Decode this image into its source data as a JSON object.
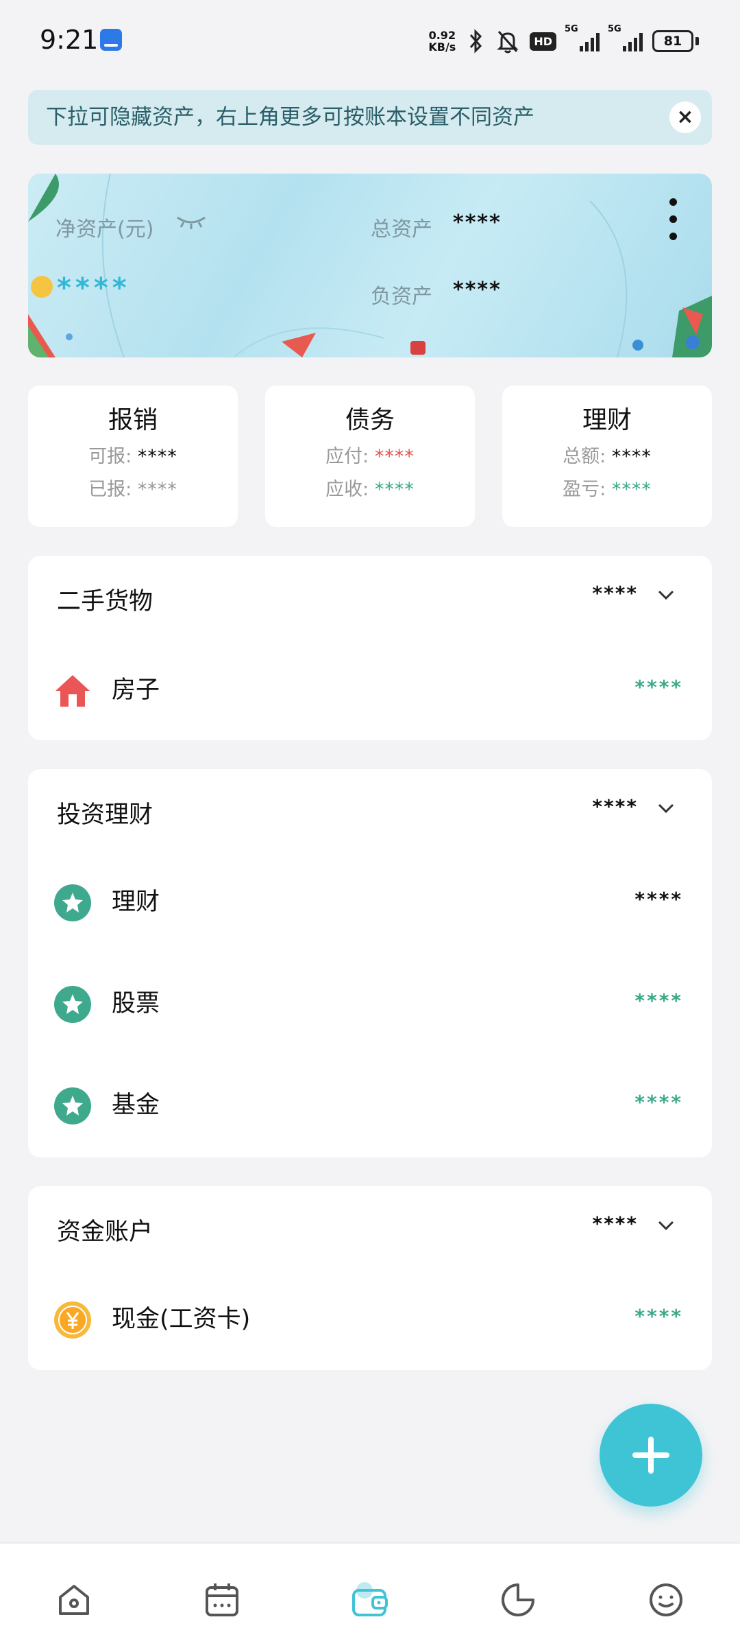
{
  "status_bar": {
    "time": "9:21",
    "net_speed_value": "0.92",
    "net_speed_unit": "KB/s",
    "hd_label": "HD",
    "signal1_label": "5G",
    "signal2_label": "5G",
    "battery": "81"
  },
  "tip": {
    "text": "下拉可隐藏资产，右上角更多可按账本设置不同资产",
    "close": "×"
  },
  "hero": {
    "net_asset_label": "净资产(元)",
    "net_asset_value": "****",
    "total_asset_label": "总资产",
    "total_asset_value": "****",
    "liability_label": "负资产",
    "liability_value": "****"
  },
  "cards": [
    {
      "title": "报销",
      "row1_label": "可报:",
      "row1_value": "****",
      "row2_label": "已报:",
      "row2_value": "****"
    },
    {
      "title": "债务",
      "row1_label": "应付:",
      "row1_value": "****",
      "row2_label": "应收:",
      "row2_value": "****"
    },
    {
      "title": "理财",
      "row1_label": "总额:",
      "row1_value": "****",
      "row2_label": "盈亏:",
      "row2_value": "****"
    }
  ],
  "sections": [
    {
      "title": "二手货物",
      "total": "****",
      "items": [
        {
          "name": "房子",
          "value": "****"
        }
      ]
    },
    {
      "title": "投资理财",
      "total": "****",
      "items": [
        {
          "name": "理财",
          "value": "****"
        },
        {
          "name": "股票",
          "value": "****"
        },
        {
          "name": "基金",
          "value": "****"
        }
      ]
    },
    {
      "title": "资金账户",
      "total": "****",
      "items": [
        {
          "name": "现金(工资卡)",
          "value": "****"
        }
      ]
    }
  ],
  "colors": {
    "accent": "#3fc4d6",
    "green": "#3aa98a",
    "red": "#e05555",
    "muted": "#999999"
  },
  "icons": {
    "nav": [
      "home-icon",
      "calendar-icon",
      "wallet-icon",
      "pie-chart-icon",
      "profile-icon"
    ],
    "fab": "plus-icon"
  }
}
